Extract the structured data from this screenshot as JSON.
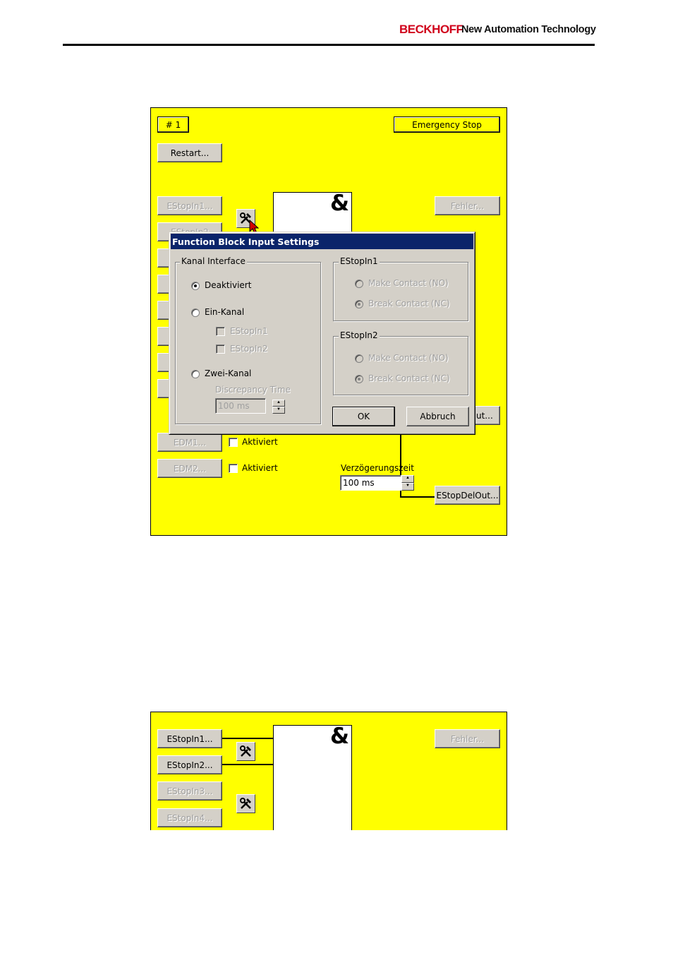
{
  "header": {
    "brand": "BECKHOFF",
    "tagline": "New Automation Technology"
  },
  "panel1": {
    "id_button": "# 1",
    "mode_button": "Emergency Stop",
    "restart_button": "Restart...",
    "estopin1_button": "EStopIn1...",
    "estopin2_button_partial": "EStopIn2",
    "fehler_button": "Fehler...",
    "edm1_button": "EDM1...",
    "edm2_button": "EDM2...",
    "edm1_check_label": "Aktiviert",
    "edm2_check_label": "Aktiviert",
    "out_button_partial": "ut...",
    "delay_label": "Verzögerungszeit",
    "delay_value": "100 ms",
    "delayed_out_button": "EStopDelOut...",
    "gate_symbol": "&"
  },
  "dialog": {
    "title": "Function Block Input Settings",
    "kanal_group": "Kanal Interface",
    "options": {
      "deaktiviert": "Deaktiviert",
      "ein_kanal": "Ein-Kanal",
      "zwei_kanal": "Zwei-Kanal"
    },
    "selected_option": "Deaktiviert",
    "ein_kanal_checks": [
      "EStopIn1",
      "EStopIn2"
    ],
    "discrepancy_label": "Discrepancy Time",
    "discrepancy_value": "100 ms",
    "estopin1_group": "EStopIn1",
    "estopin2_group": "EStopIn2",
    "make_contact": "Make Contact (NO)",
    "break_contact": "Break Contact (NC)",
    "ok_button": "OK",
    "cancel_button": "Abbruch"
  },
  "panel2": {
    "inputs": [
      "EStopIn1...",
      "EStopIn2...",
      "EStopIn3...",
      "EStopIn4..."
    ],
    "fehler_button": "Fehler...",
    "gate_symbol": "&"
  }
}
